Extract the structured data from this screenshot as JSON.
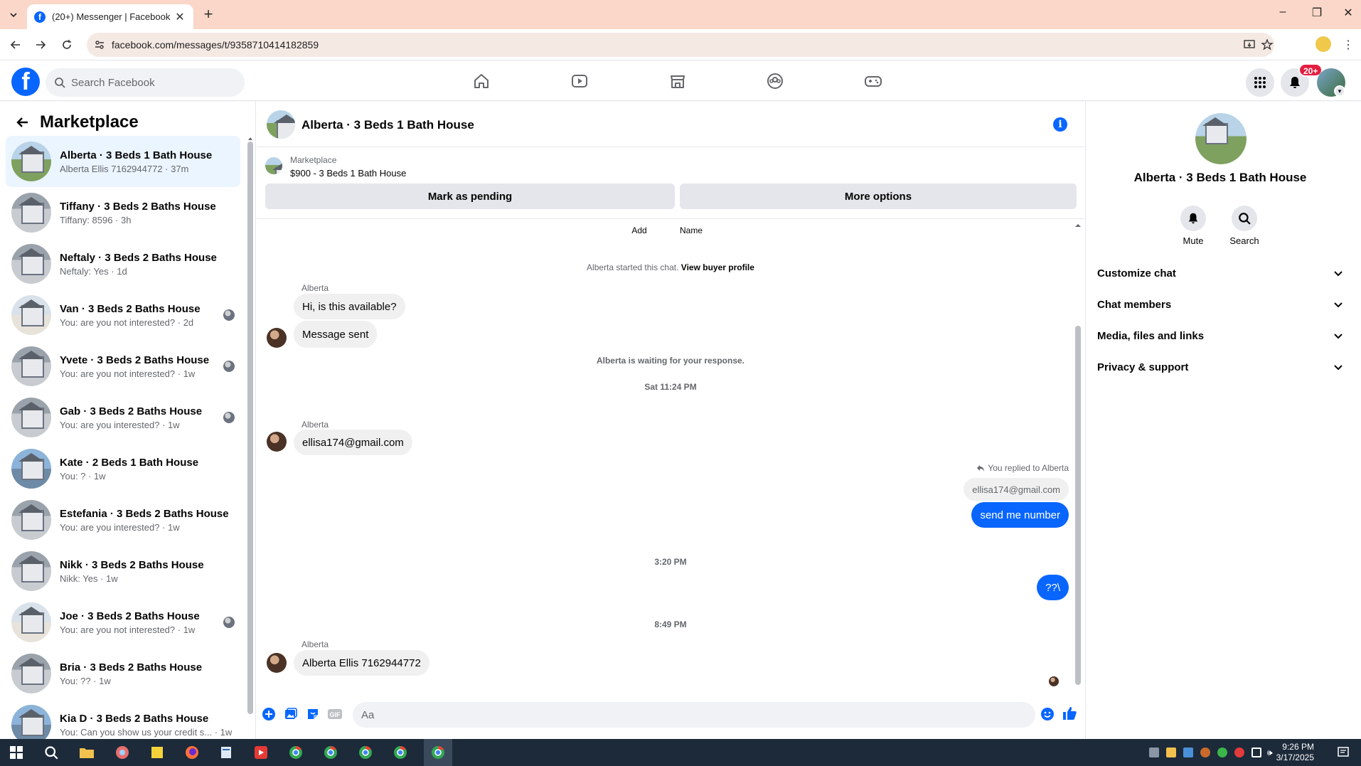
{
  "browser": {
    "tab_title": "(20+) Messenger | Facebook",
    "url": "facebook.com/messages/t/9358710414182859"
  },
  "fb": {
    "search_placeholder": "Search Facebook",
    "notification_count": "20+",
    "brand_color": "#0866ff"
  },
  "left": {
    "title": "Marketplace",
    "conversations": [
      {
        "title": "Alberta · 3 Beds 1 Bath House",
        "subtitle": "Alberta Ellis 7162944772 · 37m",
        "thumb": "house-green",
        "active": true
      },
      {
        "title": "Tiffany · 3 Beds 2 Baths House",
        "subtitle": "Tiffany: 8596 · 3h",
        "thumb": "house-gray"
      },
      {
        "title": "Neftaly · 3 Beds 2 Baths House",
        "subtitle": "Neftaly: Yes · 1d",
        "thumb": "house-gray"
      },
      {
        "title": "Van · 3 Beds 2 Baths House",
        "subtitle": "You: are you not interested? · 2d",
        "thumb": "house-light",
        "seen": true
      },
      {
        "title": "Yvete · 3 Beds 2 Baths House",
        "subtitle": "You: are you not interested? · 1w",
        "thumb": "house-gray",
        "seen": true
      },
      {
        "title": "Gab · 3 Beds 2 Baths House",
        "subtitle": "You: are you interested? · 1w",
        "thumb": "house-gray",
        "seen": true
      },
      {
        "title": "Kate · 2 Beds 1 Bath House",
        "subtitle": "You: ? · 1w",
        "thumb": "house-blue"
      },
      {
        "title": "Estefania · 3 Beds 2 Baths House",
        "subtitle": "You: are you interested? · 1w",
        "thumb": "house-gray"
      },
      {
        "title": "Nikk · 3 Beds 2 Baths House",
        "subtitle": "Nikk: Yes · 1w",
        "thumb": "house-gray"
      },
      {
        "title": "Joe · 3 Beds 2 Baths House",
        "subtitle": "You: are you not interested? · 1w",
        "thumb": "house-light",
        "seen": true
      },
      {
        "title": "Bria · 3 Beds 2 Baths House",
        "subtitle": "You: ?? · 1w",
        "thumb": "house-gray"
      },
      {
        "title": "Kia D · 3 Beds 2 Baths House",
        "subtitle": "You: Can you show us your credit s... · 1w",
        "thumb": "house-blue"
      }
    ]
  },
  "chat": {
    "title": "Alberta · 3 Beds 1 Bath House",
    "marketplace_label": "Marketplace",
    "listing_price": "$900 - 3 Beds 1 Bath House",
    "mark_pending": "Mark as pending",
    "more_options": "More options",
    "partial_actions": [
      "Add",
      "Name"
    ],
    "started_text": "Alberta started this chat.",
    "view_profile": "View buyer profile",
    "sender_name": "Alberta",
    "msg1": "Hi, is this available?",
    "msg2": "Message sent",
    "waiting": "Alberta is waiting for your response.",
    "time1": "Sat 11:24 PM",
    "msg3": "ellisa174@gmail.com",
    "reply_note": "You replied to Alberta",
    "quoted": "ellisa174@gmail.com",
    "out1": "send me number",
    "time2": "3:20 PM",
    "out2": "??\\",
    "time3": "8:49 PM",
    "msg4": "Alberta Ellis 7162944772",
    "composer_placeholder": "Aa"
  },
  "right": {
    "title": "Alberta · 3 Beds 1 Bath House",
    "mute": "Mute",
    "search": "Search",
    "sections": [
      "Customize chat",
      "Chat members",
      "Media, files and links",
      "Privacy & support"
    ]
  },
  "taskbar": {
    "time": "9:26 PM",
    "date": "3/17/2025"
  }
}
